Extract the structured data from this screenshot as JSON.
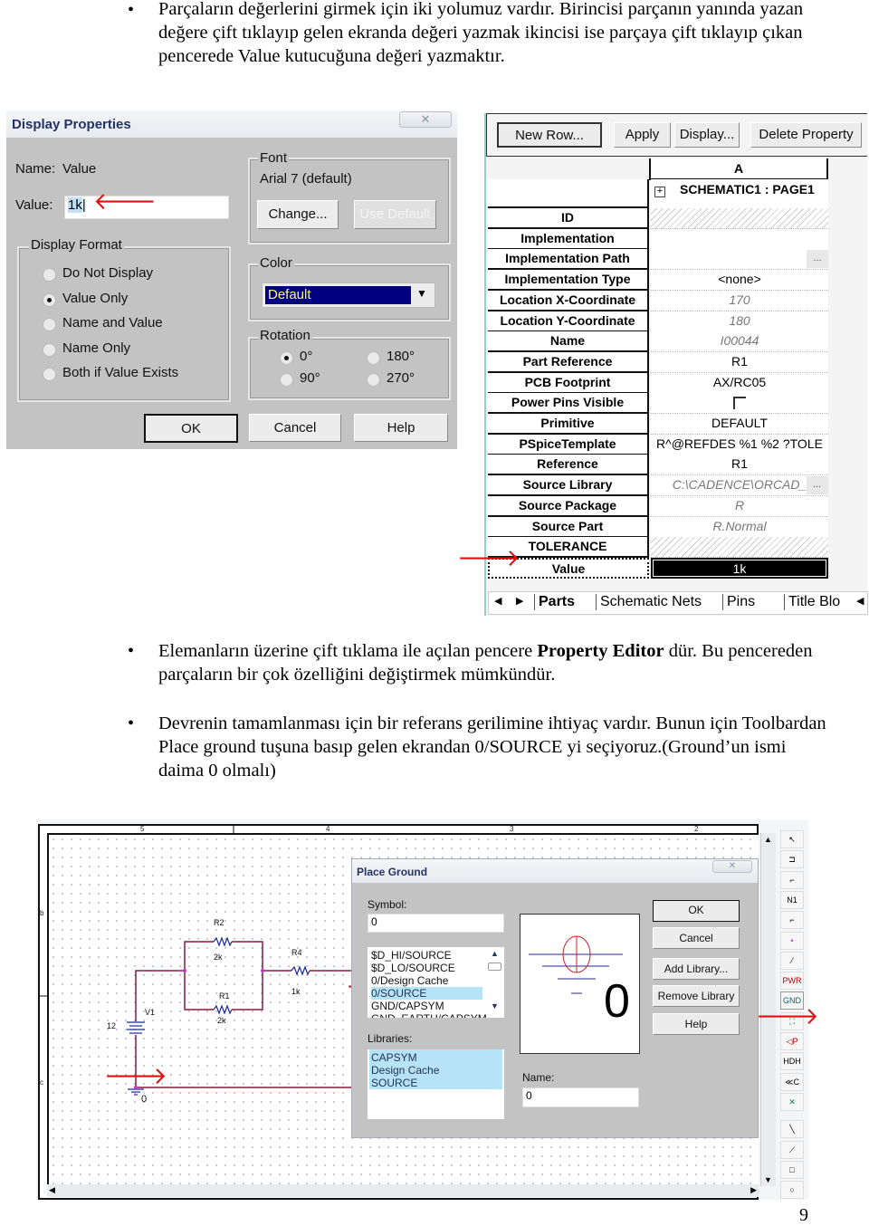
{
  "paragraphs": [
    "Parçaların değerlerini girmek için iki yolumuz vardır. Birincisi parçanın yanında yazan değere çift tıklayıp gelen ekranda değeri yazmak ikincisi ise parçaya çift tıklayıp çıkan pencerede Value kutucuğuna değeri yazmaktır.",
    {
      "before": "Elemanların üzerine çift tıklama ile açılan pencere ",
      "bold": "Property Editor",
      "after": " dür. Bu pencereden parçaların bir çok özelliğini değiştirmek mümkündür."
    },
    "Devrenin tamamlanması için bir referans gerilimine ihtiyaç vardır. Bunun için Toolbardan Place ground tuşuna basıp gelen ekrandan 0/SOURCE yi seçiyoruz.(Ground’un ismi daima 0 olmalı)"
  ],
  "bullet": "•",
  "arrow": "🡒",
  "page_number": "9",
  "display_properties": {
    "title": "Display Properties",
    "close": "✕",
    "name_label": "Name:",
    "name_value": "Value",
    "value_label": "Value:",
    "value": "1k",
    "display_format": {
      "label": "Display Format",
      "options": [
        "Do Not Display",
        "Value Only",
        "Name and Value",
        "Name Only",
        "Both if Value Exists"
      ],
      "selected": "Value Only"
    },
    "font": {
      "label": "Font",
      "value": "Arial 7 (default)",
      "change": "Change...",
      "use_default": "Use Default"
    },
    "color": {
      "label": "Color",
      "value": "Default"
    },
    "rotation": {
      "label": "Rotation",
      "options": [
        "0°",
        "180°",
        "90°",
        "270°"
      ],
      "selected": "0°"
    },
    "buttons": {
      "ok": "OK",
      "cancel": "Cancel",
      "help": "Help"
    }
  },
  "property_editor": {
    "buttons": [
      "New Row...",
      "Apply",
      "Display...",
      "Delete Property"
    ],
    "column_header": "A",
    "group_row": "SCHEMATIC1 : PAGE1",
    "rows": [
      {
        "name": "ID",
        "value": "",
        "kind": "hatched"
      },
      {
        "name": "Implementation",
        "value": "",
        "kind": "normal"
      },
      {
        "name": "Implementation Path",
        "value": "",
        "kind": "browse"
      },
      {
        "name": "Implementation Type",
        "value": "<none>",
        "kind": "normal"
      },
      {
        "name": "Location X-Coordinate",
        "value": "170",
        "kind": "italic"
      },
      {
        "name": "Location Y-Coordinate",
        "value": "180",
        "kind": "italic"
      },
      {
        "name": "Name",
        "value": "I00044",
        "kind": "italic"
      },
      {
        "name": "Part Reference",
        "value": "R1",
        "kind": "normal"
      },
      {
        "name": "PCB Footprint",
        "value": "AX/RC05",
        "kind": "normal"
      },
      {
        "name": "Power Pins Visible",
        "value": "",
        "kind": "checkbox",
        "checked": false
      },
      {
        "name": "Primitive",
        "value": "DEFAULT",
        "kind": "normal"
      },
      {
        "name": "PSpiceTemplate",
        "value": "R^@REFDES %1 %2 ?TOLE",
        "kind": "normal"
      },
      {
        "name": "Reference",
        "value": "R1",
        "kind": "normal"
      },
      {
        "name": "Source Library",
        "value": "C:\\CADENCE\\ORCAD_",
        "kind": "italic-browse"
      },
      {
        "name": "Source Package",
        "value": "R",
        "kind": "italic"
      },
      {
        "name": "Source Part",
        "value": "R.Normal",
        "kind": "italic"
      },
      {
        "name": "TOLERANCE",
        "value": "",
        "kind": "hatched"
      },
      {
        "name": "Value",
        "value": "1k",
        "kind": "selected"
      }
    ],
    "tabs": [
      "Parts",
      "Schematic Nets",
      "Pins",
      "Title Blo"
    ],
    "active_tab": "Parts"
  },
  "schematic": {
    "ruler_top": [
      "5",
      "4",
      "3",
      "2"
    ],
    "ruler_left": [
      "b",
      "c"
    ],
    "labels": {
      "r2": "R2",
      "r2_val": "2k",
      "r1": "R1",
      "r1_val": "2k",
      "r4": "R4",
      "r4_val": "1k",
      "v1": "V1",
      "v1_val": "12",
      "gnd": "0"
    },
    "wire_color": "#8b1a3a",
    "node_color": "#cc33cc",
    "toolbar": [
      "select-icon",
      "place-part-icon",
      "place-wire-icon",
      "net-alias-icon",
      "place-bus-icon",
      "junction-icon",
      "bus-entry-icon",
      "power-icon",
      "ground-icon",
      "hierarchical-block-icon",
      "hierarchical-port-icon",
      "hierarchical-pin-icon",
      "off-page-connector-icon",
      "no-connect-icon",
      "line-icon",
      "polyline-icon",
      "rectangle-icon",
      "ellipse-icon"
    ],
    "toolbar_text": [
      "↖",
      "⊐",
      "⌐",
      "N1",
      "⌐",
      "•",
      "⁄",
      "PWR",
      "GND",
      "⛶",
      "◁P",
      "HDH",
      "≪C",
      "✕",
      "╲",
      "⟋",
      "□",
      "○"
    ]
  },
  "place_ground": {
    "title": "Place Ground",
    "close": "✕",
    "symbol_label": "Symbol:",
    "symbol_value": "0",
    "symbols": [
      "$D_HI/SOURCE",
      "$D_LO/SOURCE",
      "0/Design Cache",
      "0/SOURCE",
      "GND/CAPSYM",
      "GND_EARTH/CAPSYM"
    ],
    "selected_symbol": "0/SOURCE",
    "libraries_label": "Libraries:",
    "libraries": [
      "CAPSYM",
      "Design Cache",
      "SOURCE"
    ],
    "preview_text": "0",
    "name_label": "Name:",
    "name_value": "0",
    "buttons": {
      "ok": "OK",
      "cancel": "Cancel",
      "add_library": "Add Library...",
      "remove_library": "Remove Library",
      "help": "Help"
    }
  }
}
